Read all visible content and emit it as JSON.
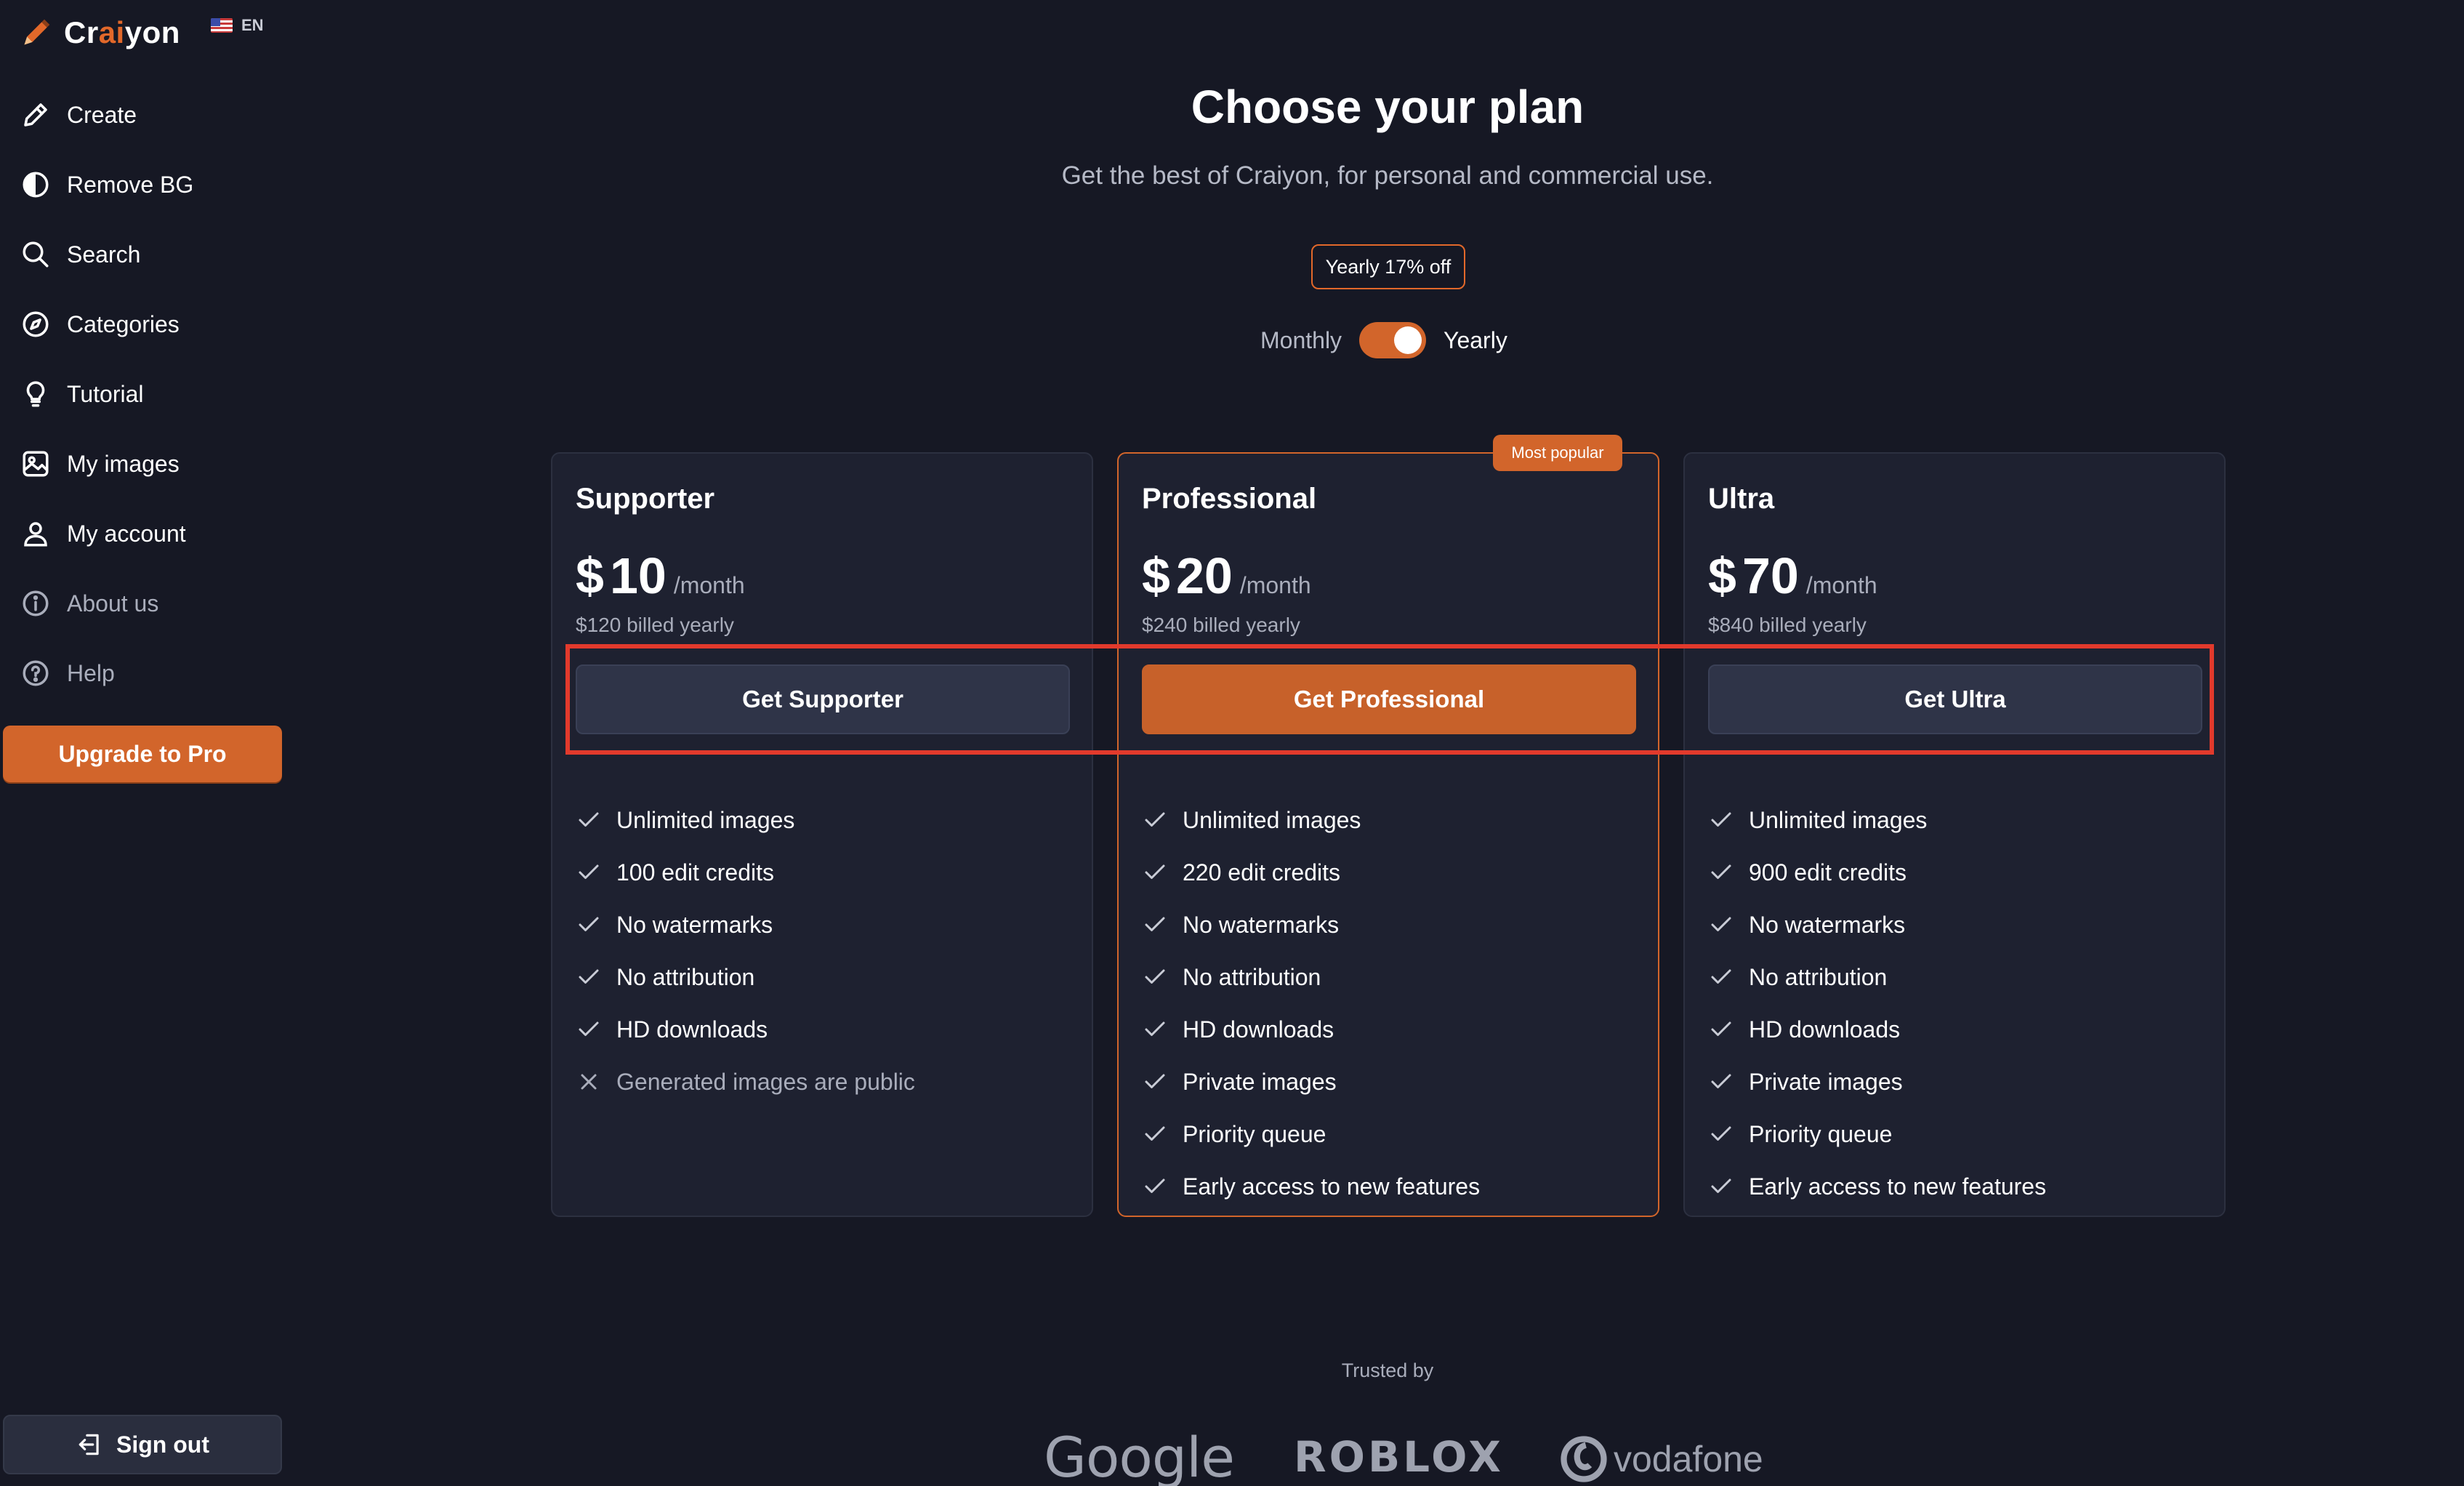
{
  "brand": {
    "name_prefix": "Cr",
    "name_ai": "ai",
    "name_suffix": "yon",
    "language": "EN"
  },
  "nav": [
    {
      "label": "Create",
      "icon": "pencil-icon"
    },
    {
      "label": "Remove BG",
      "icon": "contrast-icon"
    },
    {
      "label": "Search",
      "icon": "search-icon"
    },
    {
      "label": "Categories",
      "icon": "compass-icon"
    },
    {
      "label": "Tutorial",
      "icon": "lightbulb-icon"
    },
    {
      "label": "My images",
      "icon": "image-icon"
    },
    {
      "label": "My account",
      "icon": "user-icon"
    },
    {
      "label": "About us",
      "icon": "info-icon"
    },
    {
      "label": "Help",
      "icon": "help-icon"
    }
  ],
  "sidebar": {
    "upgrade_label": "Upgrade to Pro",
    "signout_label": "Sign out"
  },
  "page": {
    "title": "Choose your plan",
    "subtitle": "Get the best of Craiyon, for personal and commercial use.",
    "discount_badge": "Yearly 17% off",
    "billing": {
      "monthly_label": "Monthly",
      "yearly_label": "Yearly",
      "selected": "Yearly"
    },
    "popular_badge": "Most popular",
    "trusted_by": "Trusted by",
    "logos": [
      "Google",
      "ROBLOX",
      "vodafone"
    ]
  },
  "plans": [
    {
      "name": "Supporter",
      "currency": "$",
      "price": "10",
      "period": "/month",
      "billed": "$120 billed yearly",
      "cta": "Get Supporter",
      "features": [
        {
          "text": "Unlimited images",
          "included": true
        },
        {
          "text": "100 edit credits",
          "included": true
        },
        {
          "text": "No watermarks",
          "included": true
        },
        {
          "text": "No attribution",
          "included": true
        },
        {
          "text": "HD downloads",
          "included": true
        },
        {
          "text": "Generated images are public",
          "included": false
        }
      ]
    },
    {
      "name": "Professional",
      "currency": "$",
      "price": "20",
      "period": "/month",
      "billed": "$240 billed yearly",
      "cta": "Get Professional",
      "features": [
        {
          "text": "Unlimited images",
          "included": true
        },
        {
          "text": "220 edit credits",
          "included": true
        },
        {
          "text": "No watermarks",
          "included": true
        },
        {
          "text": "No attribution",
          "included": true
        },
        {
          "text": "HD downloads",
          "included": true
        },
        {
          "text": "Private images",
          "included": true
        },
        {
          "text": "Priority queue",
          "included": true
        },
        {
          "text": "Early access to new features",
          "included": true
        }
      ]
    },
    {
      "name": "Ultra",
      "currency": "$",
      "price": "70",
      "period": "/month",
      "billed": "$840 billed yearly",
      "cta": "Get Ultra",
      "features": [
        {
          "text": "Unlimited images",
          "included": true
        },
        {
          "text": "900 edit credits",
          "included": true
        },
        {
          "text": "No watermarks",
          "included": true
        },
        {
          "text": "No attribution",
          "included": true
        },
        {
          "text": "HD downloads",
          "included": true
        },
        {
          "text": "Private images",
          "included": true
        },
        {
          "text": "Priority queue",
          "included": true
        },
        {
          "text": "Early access to new features",
          "included": true
        }
      ]
    }
  ],
  "colors": {
    "background": "#161824",
    "card": "#1e2130",
    "accent": "#d2652b",
    "highlight": "#e23a2c"
  }
}
